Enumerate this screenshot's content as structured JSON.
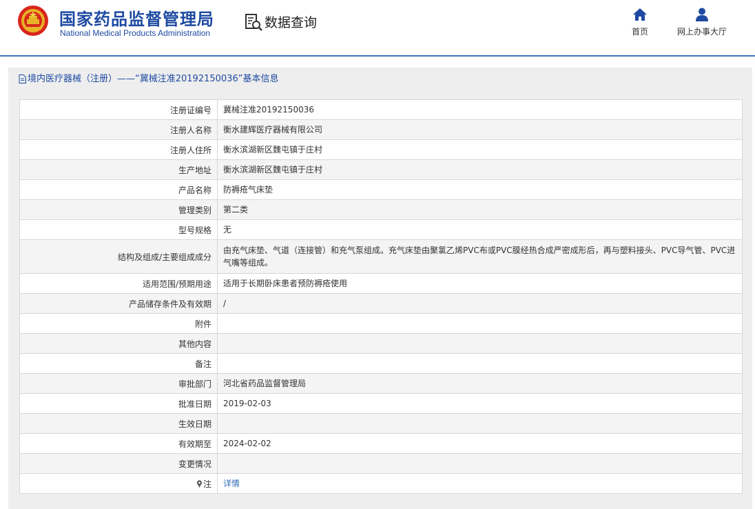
{
  "header": {
    "org_name_cn": "国家药品监督管理局",
    "org_name_en": "National Medical Products Administration",
    "emblem_icon": "national-emblem-icon",
    "query_icon": "document-search-icon",
    "query_title": "数据查询",
    "nav": [
      {
        "label": "首页",
        "icon": "home-icon"
      },
      {
        "label": "网上办事大厅",
        "icon": "user-icon"
      }
    ],
    "brand_color": "#1e4aa2"
  },
  "panel": {
    "title_icon": "document-icon",
    "title": "境内医疗器械（注册）——“冀械注准20192150036”基本信息"
  },
  "table": {
    "rows": [
      {
        "label": "注册证编号",
        "value": "冀械注准20192150036"
      },
      {
        "label": "注册人名称",
        "value": "衡水建辉医疗器械有限公司"
      },
      {
        "label": "注册人住所",
        "value": "衡水滨湖新区魏屯镇于庄村"
      },
      {
        "label": "生产地址",
        "value": "衡水滨湖新区魏屯镇于庄村"
      },
      {
        "label": "产品名称",
        "value": "防褥疮气床垫"
      },
      {
        "label": "管理类别",
        "value": "第二类"
      },
      {
        "label": "型号规格",
        "value": "无"
      },
      {
        "label": "结构及组成/主要组成成分",
        "value": "由充气床垫、气道（连接管）和充气泵组成。充气床垫由聚氯乙烯PVC布或PVC膜经热合成严密成形后，再与塑料接头、PVC导气管、PVC进气嘴等组成。"
      },
      {
        "label": "适用范围/预期用途",
        "value": "适用于长期卧床患者预防褥疮使用"
      },
      {
        "label": "产品储存条件及有效期",
        "value": "/"
      },
      {
        "label": "附件",
        "value": ""
      },
      {
        "label": "其他内容",
        "value": ""
      },
      {
        "label": "备注",
        "value": ""
      },
      {
        "label": "审批部门",
        "value": "河北省药品监督管理局"
      },
      {
        "label": "批准日期",
        "value": "2019-02-03"
      },
      {
        "label": "生效日期",
        "value": ""
      },
      {
        "label": "有效期至",
        "value": "2024-02-02"
      },
      {
        "label": "变更情况",
        "value": ""
      }
    ],
    "note": {
      "icon": "pin-icon",
      "label": "注",
      "link": "详情"
    }
  }
}
